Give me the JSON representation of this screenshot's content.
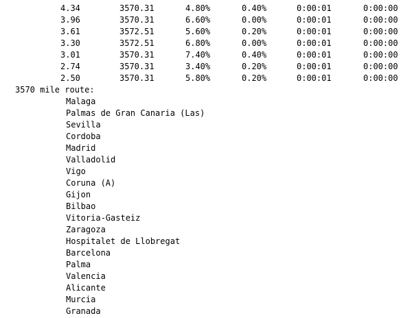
{
  "table": {
    "rows": [
      [
        "4.34",
        "3570.31",
        "4.80%",
        "0.40%",
        "0:00:01",
        "0:00:00"
      ],
      [
        "3.96",
        "3570.31",
        "6.60%",
        "0.00%",
        "0:00:01",
        "0:00:00"
      ],
      [
        "3.61",
        "3572.51",
        "5.60%",
        "0.20%",
        "0:00:01",
        "0:00:00"
      ],
      [
        "3.30",
        "3572.51",
        "6.80%",
        "0.00%",
        "0:00:01",
        "0:00:00"
      ],
      [
        "3.01",
        "3570.31",
        "7.40%",
        "0.40%",
        "0:00:01",
        "0:00:00"
      ],
      [
        "2.74",
        "3570.31",
        "3.40%",
        "0.20%",
        "0:00:01",
        "0:00:00"
      ],
      [
        "2.50",
        "3570.31",
        "5.80%",
        "0.20%",
        "0:00:01",
        "0:00:00"
      ]
    ]
  },
  "route": {
    "heading": "3570 mile route:",
    "cities": [
      "Malaga",
      "Palmas de Gran Canaria (Las)",
      "Sevilla",
      "Cordoba",
      "Madrid",
      "Valladolid",
      "Vigo",
      "Coruna (A)",
      "Gijon",
      "Bilbao",
      "Vitoria-Gasteiz",
      "Zaragoza",
      "Hospitalet de Llobregat",
      "Barcelona",
      "Palma",
      "Valencia",
      "Alicante",
      "Murcia",
      "Granada"
    ]
  }
}
